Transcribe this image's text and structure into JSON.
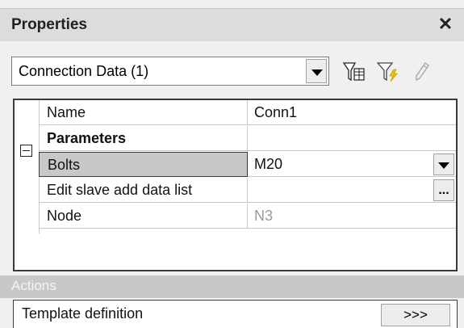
{
  "panel": {
    "title": "Properties",
    "close_glyph": "✕"
  },
  "selector": {
    "value": "Connection Data (1)"
  },
  "toolbar": {
    "icons": [
      "filter-table-icon",
      "filter-lightning-icon",
      "edit-pencil-icon"
    ]
  },
  "grid": {
    "collapse_glyph": "minus-box",
    "rows": [
      {
        "name": "Name",
        "value": "Conn1"
      },
      {
        "name": "Parameters",
        "value": ""
      },
      {
        "name": "Bolts",
        "value": "M20"
      },
      {
        "name": "Edit slave add data list",
        "value": "",
        "button": "..."
      },
      {
        "name": "Node",
        "value": "N3"
      }
    ]
  },
  "actions": {
    "header": "Actions",
    "item_label": "Template definition",
    "button_label": ">>>"
  },
  "colors": {
    "titlebar_bg": "#dcdcdc",
    "selected_row_bg": "#c8c8c8",
    "disabled_text": "#9a9a9a"
  }
}
